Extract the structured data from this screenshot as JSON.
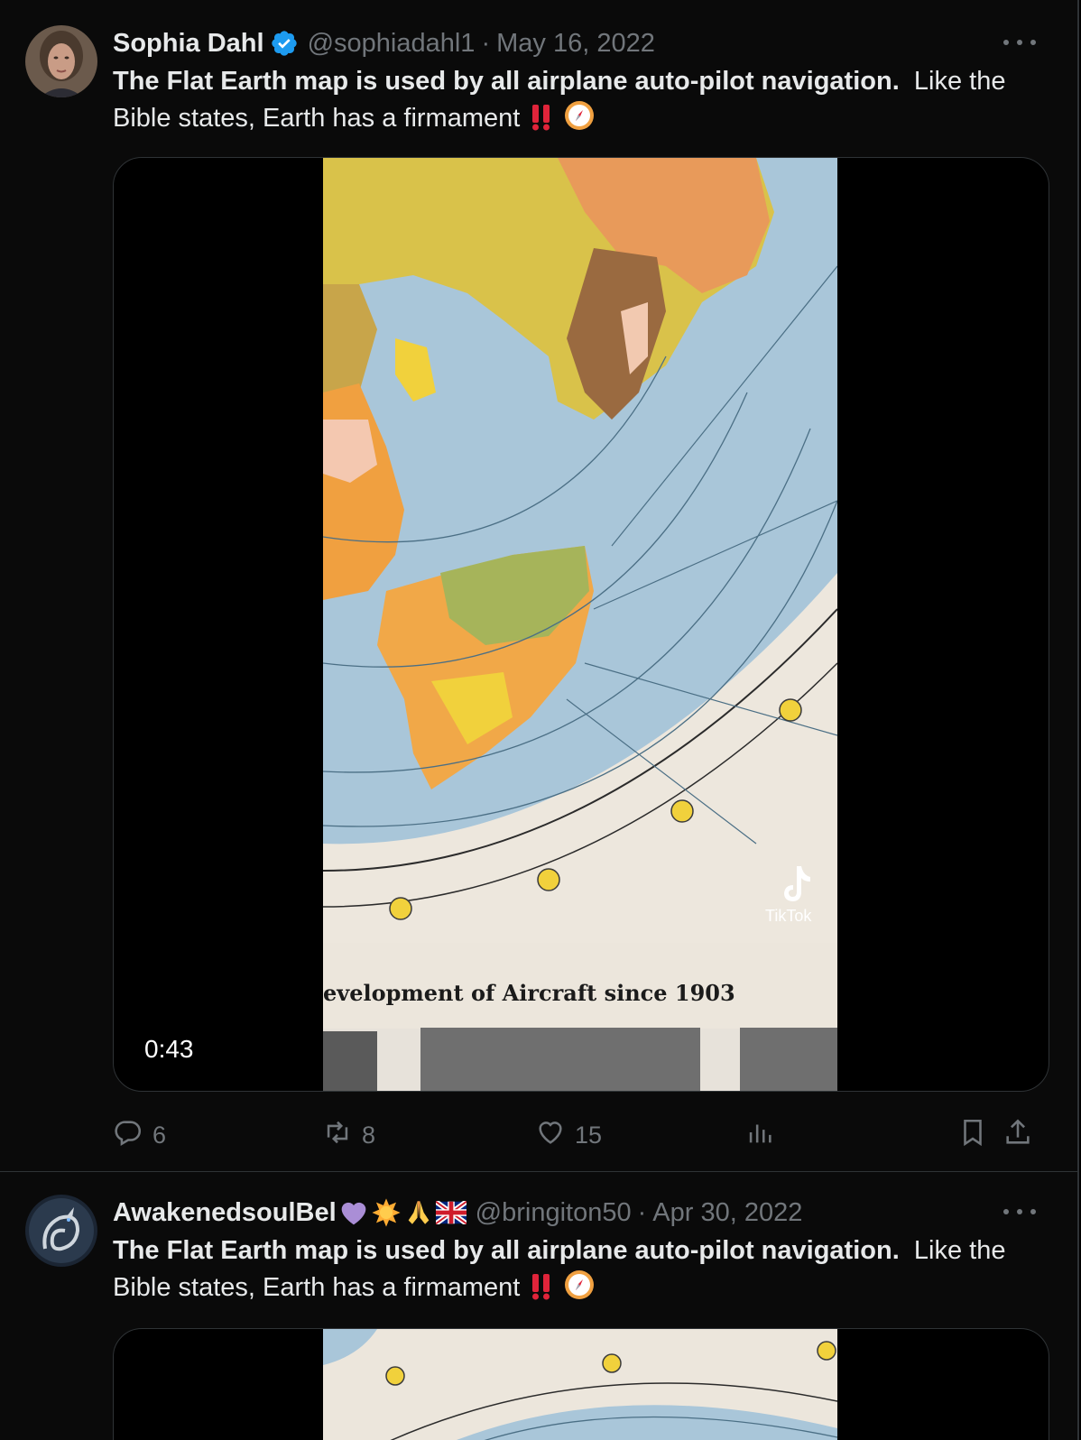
{
  "tweets": [
    {
      "author": {
        "name": "Sophia Dahl",
        "verified": true,
        "handle": "@sophiadahl1",
        "emojis": []
      },
      "separator": "·",
      "date": "May 16, 2022",
      "text": {
        "bold": "The Flat Earth map is used by all airplane auto-pilot navigation.",
        "regular": "  Like the Bible states, Earth has a firmament"
      },
      "media": {
        "duration": "0:43",
        "map_caption": "evelopment of Aircraft since 1903",
        "watermark": "TikTok"
      },
      "actions": {
        "replies": "6",
        "retweets": "8",
        "likes": "15"
      }
    },
    {
      "author": {
        "name": "AwakenedsoulBel",
        "verified": false,
        "handle": "@bringiton50",
        "emojis": [
          "purple-heart",
          "sun",
          "folded-hands",
          "uk-flag"
        ]
      },
      "separator": "·",
      "date": "Apr 30, 2022",
      "text": {
        "bold": "The Flat Earth map is used by all airplane auto-pilot navigation.",
        "regular": "  Like the Bible states, Earth has a firmament"
      }
    }
  ],
  "icons": {
    "reply": "reply-icon",
    "retweet": "retweet-icon",
    "like": "heart-icon",
    "views": "views-icon",
    "bookmark": "bookmark-icon",
    "share": "share-icon",
    "more": "more-icon",
    "verified": "verified-badge-icon",
    "double_exclamation": "double-exclamation-icon",
    "compass": "compass-icon"
  },
  "colors": {
    "background": "#0a0a0a",
    "text": "#e7e9ea",
    "secondary": "#71767b",
    "verified": "#1d9bf0",
    "border": "#2f3336"
  }
}
